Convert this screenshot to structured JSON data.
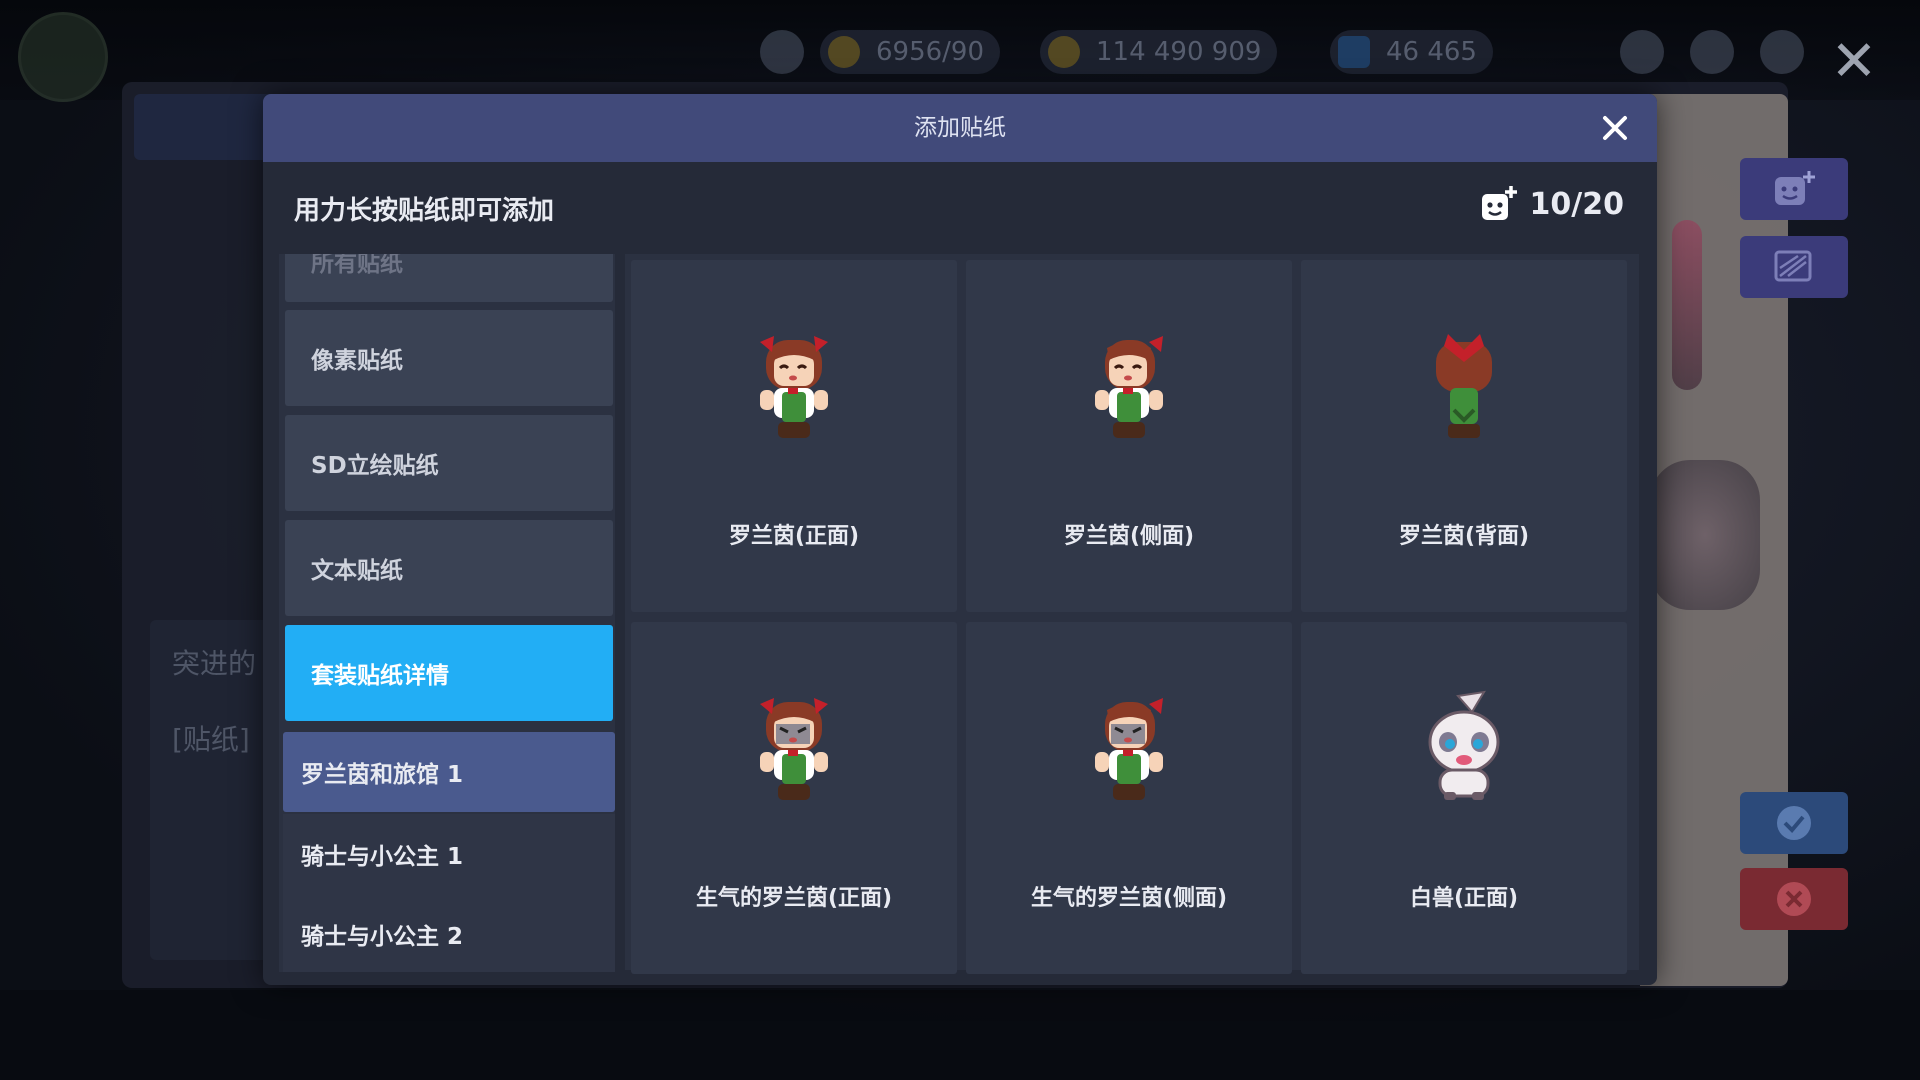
{
  "modal": {
    "title": "添加贴纸",
    "hint": "用力长按贴纸即可添加",
    "counter": "10/20"
  },
  "categories": [
    {
      "label": "所有贴纸",
      "state": "partially-visible"
    },
    {
      "label": "像素贴纸"
    },
    {
      "label": "SD立绘贴纸"
    },
    {
      "label": "文本贴纸"
    },
    {
      "label": "套装贴纸详情",
      "active": true
    }
  ],
  "sub_sets": [
    {
      "label": "罗兰茵和旅馆 1",
      "selected": true
    },
    {
      "label": "骑士与小公主 1"
    },
    {
      "label": "骑士与小公主 2"
    }
  ],
  "stickers": [
    {
      "name": "罗兰茵(正面)",
      "sprite": "girl-front",
      "face": "happy"
    },
    {
      "name": "罗兰茵(侧面)",
      "sprite": "girl-side",
      "face": "happy"
    },
    {
      "name": "罗兰茵(背面)",
      "sprite": "girl-back",
      "face": "none"
    },
    {
      "name": "生气的罗兰茵(正面)",
      "sprite": "girl-front",
      "face": "angry"
    },
    {
      "name": "生气的罗兰茵(侧面)",
      "sprite": "girl-side",
      "face": "angry"
    },
    {
      "name": "白兽(正面)",
      "sprite": "white-beast",
      "face": "none"
    }
  ],
  "background": {
    "stats": [
      "6956/90",
      "114 490 909",
      "46 465"
    ],
    "left_panel_text": [
      "突进的",
      "[贴纸]"
    ]
  },
  "colors": {
    "header": "#414a7a",
    "active_category": "#22aef5",
    "selected_set": "#4a5a8e",
    "card": "#313849",
    "panel": "#252a38"
  }
}
